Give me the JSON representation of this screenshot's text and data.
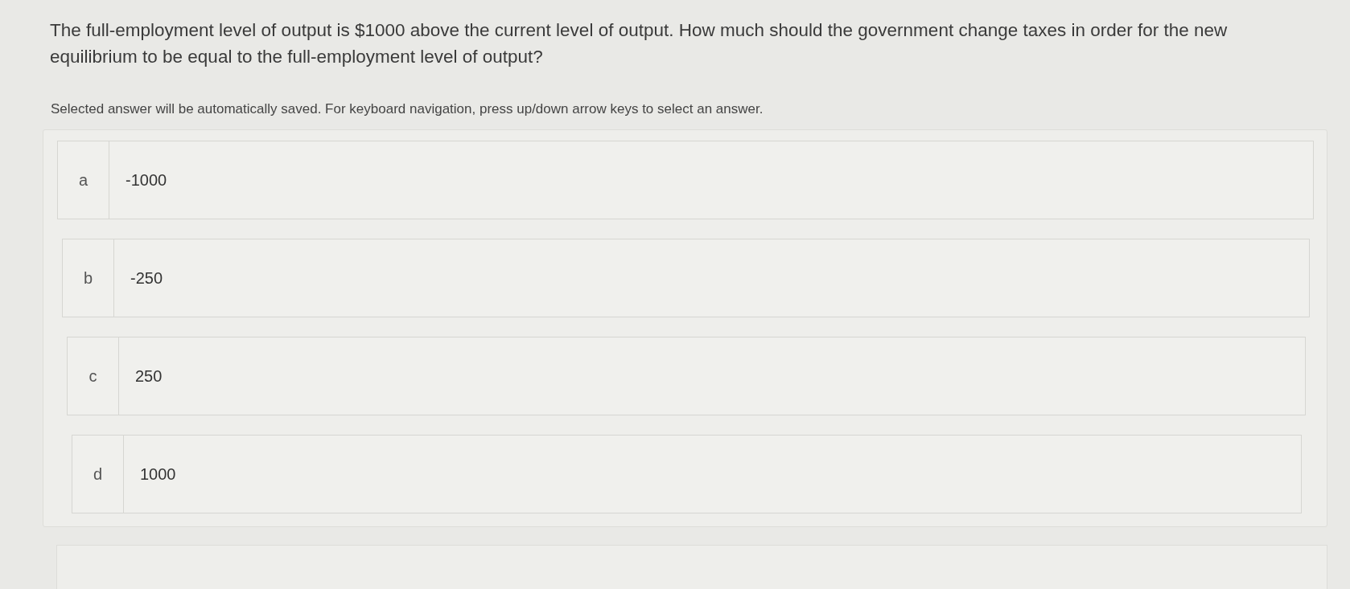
{
  "question": "The full-employment level of output is $1000 above the current level of output. How much should the government change taxes in order for the new equilibrium to be equal to the full-employment level of output?",
  "instructions": "Selected answer will be automatically saved. For keyboard navigation, press up/down arrow keys to select an answer.",
  "options": [
    {
      "letter": "a",
      "text": "-1000",
      "selected": false
    },
    {
      "letter": "b",
      "text": "-250",
      "selected": false
    },
    {
      "letter": "c",
      "text": "250",
      "selected": false
    },
    {
      "letter": "d",
      "text": "1000",
      "selected": false
    }
  ]
}
